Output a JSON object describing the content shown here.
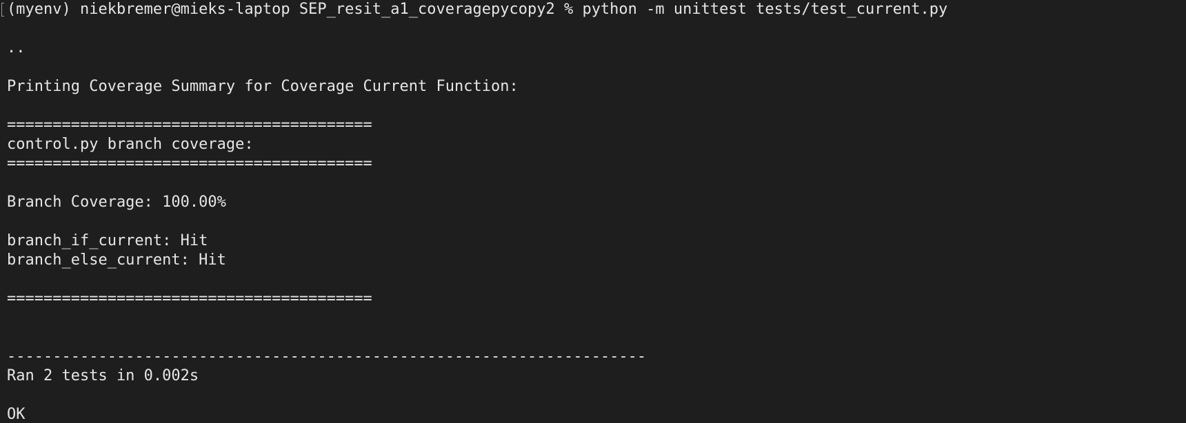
{
  "terminal": {
    "background": "#1e1e1e",
    "foreground": "#e6e6e6",
    "command_line": "(myenv) niekbremer@mieks-laptop SEP_resit_a1_coveragepycopy2 % python -m unittest tests/test_current.py",
    "lines": [
      "",
      "..",
      "",
      "Printing Coverage Summary for Coverage Current Function:",
      "",
      "========================================",
      "control.py branch coverage:",
      "========================================",
      "",
      "Branch Coverage: 100.00%",
      "",
      "branch_if_current: Hit",
      "branch_else_current: Hit",
      "",
      "========================================",
      "",
      "",
      "----------------------------------------------------------------------",
      "Ran 2 tests in 0.002s",
      "",
      "OK"
    ]
  }
}
